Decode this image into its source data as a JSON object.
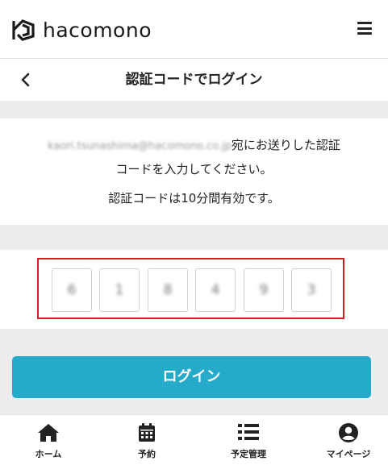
{
  "header": {
    "brand": "hacomono",
    "menu_icon": "hamburger-menu-icon"
  },
  "subheader": {
    "title": "認証コードでログイン",
    "back_icon": "chevron-left-icon"
  },
  "message": {
    "email": "kaori.tsunashima@hacomono.co.jp",
    "line1_suffix": "宛にお送りした認証",
    "line2": "コードを入力してください。",
    "line3": "認証コードは10分間有効です。"
  },
  "code": {
    "digits": [
      "6",
      "1",
      "8",
      "4",
      "9",
      "3"
    ],
    "highlight_color": "#d71920"
  },
  "login_button": {
    "label": "ログイン",
    "color": "#26aac9"
  },
  "tabbar": {
    "items": [
      {
        "label": "ホーム",
        "icon": "home-icon"
      },
      {
        "label": "予約",
        "icon": "calendar-icon"
      },
      {
        "label": "予定管理",
        "icon": "list-icon"
      },
      {
        "label": "マイページ",
        "icon": "user-icon"
      }
    ]
  }
}
